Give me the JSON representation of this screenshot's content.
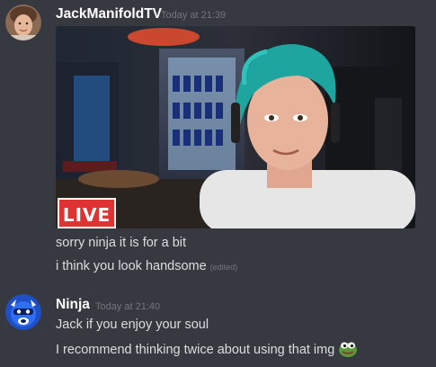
{
  "messages": [
    {
      "author": "JackManifoldTV",
      "timestamp": "Today at 21:39",
      "image_badge": "LIVE",
      "lines": [
        "sorry ninja it is for a bit",
        "i think you look handsome"
      ],
      "edited_label": "(edited)"
    },
    {
      "author": "Ninja",
      "timestamp": "Today at 21:40",
      "lines": [
        "Jack if you enjoy your soul",
        "I recommend thinking twice about using that img"
      ],
      "emoji_icon": "pepe-frog-emoji-icon"
    }
  ],
  "colors": {
    "background": "#36393f",
    "username": "#ffffff",
    "timestamp": "#72767d",
    "message_text": "#dcddde",
    "live_badge": "#e03232"
  }
}
